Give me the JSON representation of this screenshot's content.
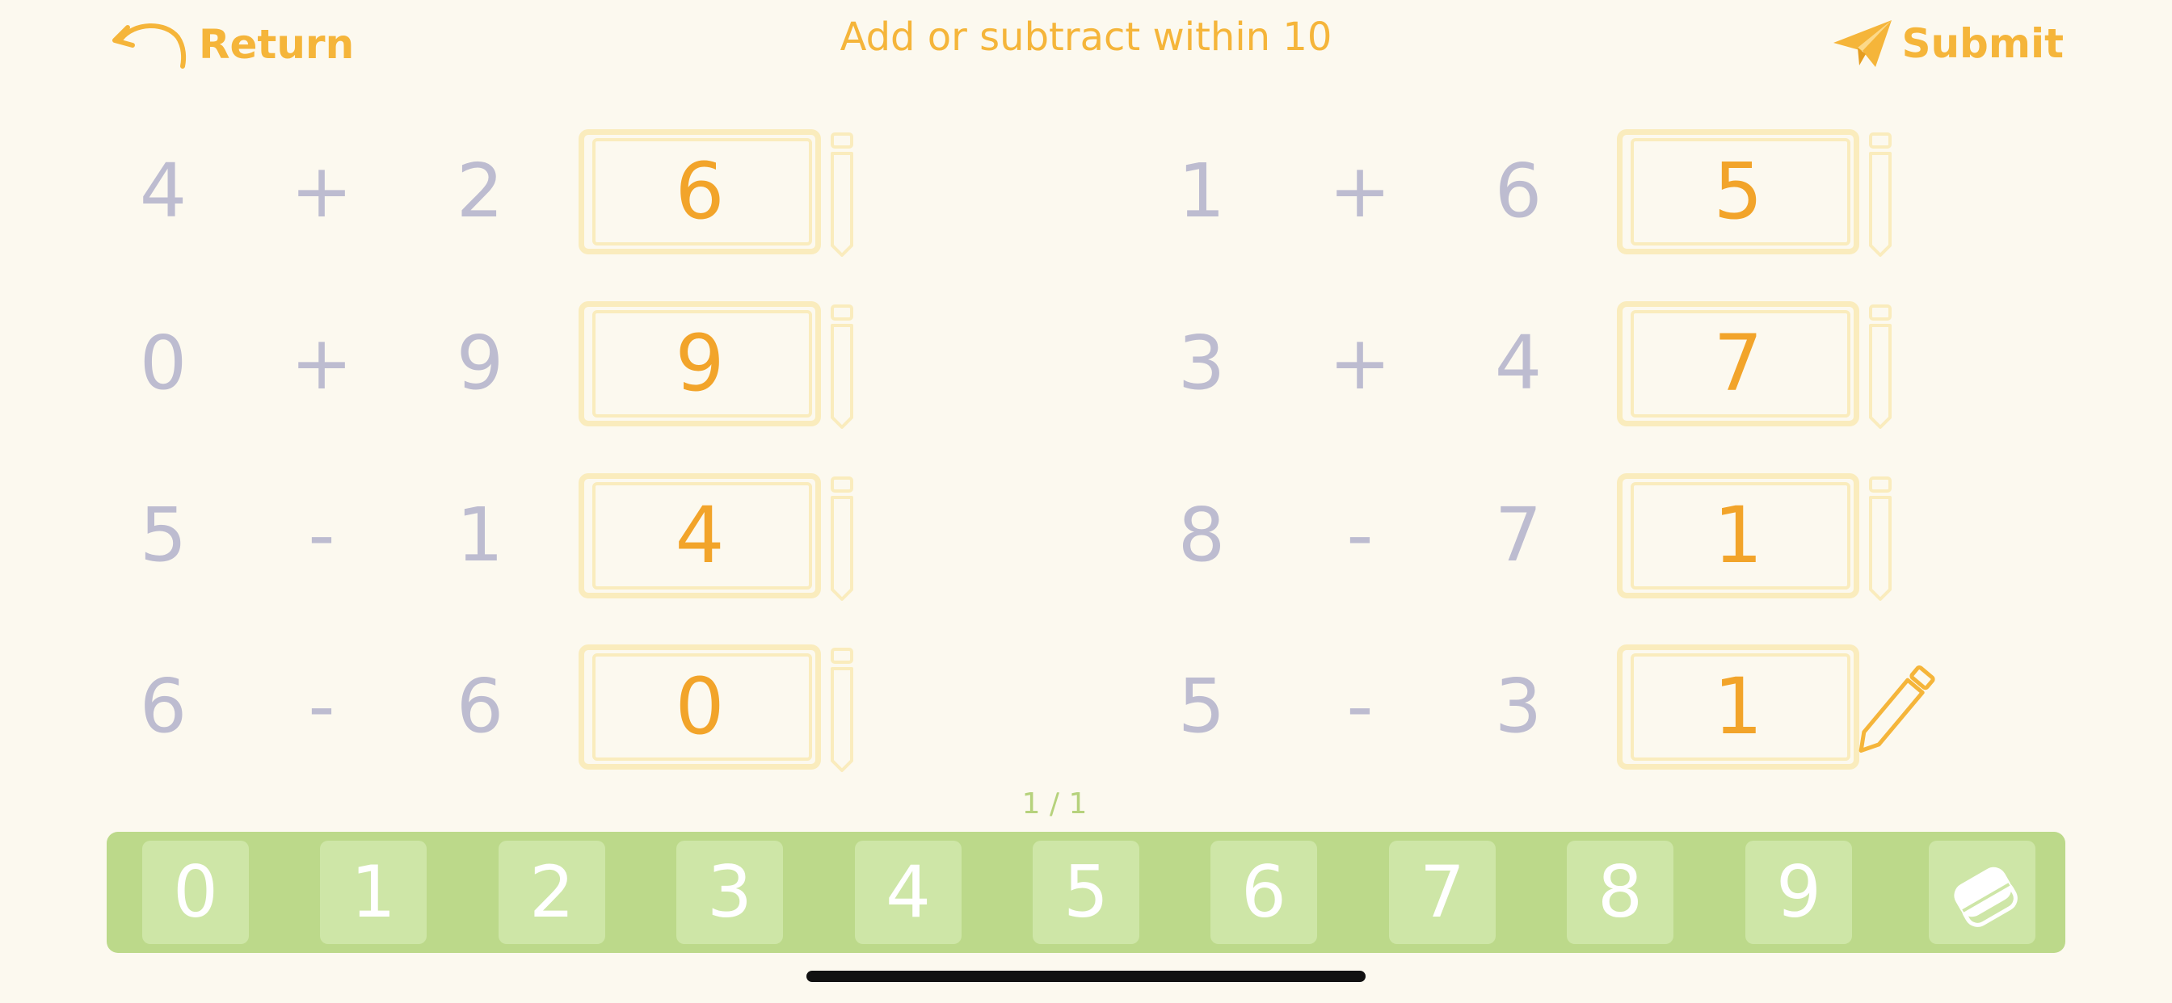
{
  "header": {
    "return_label": "Return",
    "title": "Add or subtract within 10",
    "submit_label": "Submit"
  },
  "problems": [
    {
      "a": "4",
      "op": "+",
      "b": "2",
      "eq": "=",
      "answer": "6"
    },
    {
      "a": "1",
      "op": "+",
      "b": "6",
      "eq": "=",
      "answer": "5"
    },
    {
      "a": "0",
      "op": "+",
      "b": "9",
      "eq": "=",
      "answer": "9"
    },
    {
      "a": "3",
      "op": "+",
      "b": "4",
      "eq": "=",
      "answer": "7"
    },
    {
      "a": "5",
      "op": "-",
      "b": "1",
      "eq": "=",
      "answer": "4"
    },
    {
      "a": "8",
      "op": "-",
      "b": "7",
      "eq": "=",
      "answer": "1"
    },
    {
      "a": "6",
      "op": "-",
      "b": "6",
      "eq": "=",
      "answer": "0"
    },
    {
      "a": "5",
      "op": "-",
      "b": "3",
      "eq": "=",
      "answer": "1"
    }
  ],
  "pager": {
    "text": "1 / 1"
  },
  "keypad": {
    "keys": [
      "0",
      "1",
      "2",
      "3",
      "4",
      "5",
      "6",
      "7",
      "8",
      "9"
    ],
    "eraser_icon": "eraser-icon"
  },
  "colors": {
    "accent": "#f5b53a",
    "answer_text": "#f2a42a",
    "operand_text": "#bdbcd0",
    "answer_border": "#faecbd",
    "keypad_bg": "#bcd98a",
    "key_bg": "#cee6a7",
    "background": "#fcf9ef"
  }
}
